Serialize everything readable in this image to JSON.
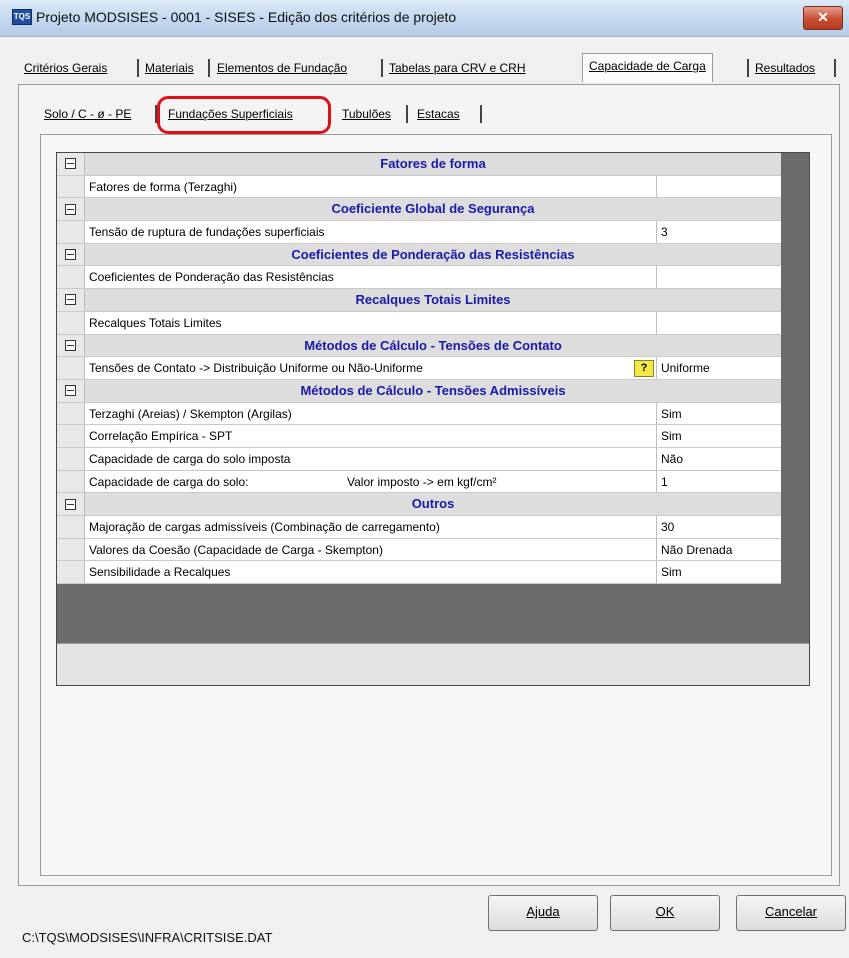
{
  "window": {
    "app_icon": "TQS",
    "title": "Projeto MODSISES - 0001 - SISES - Edição dos critérios de projeto",
    "close_label": "✕"
  },
  "main_tabs": [
    {
      "label": "Critérios Gerais",
      "active": false
    },
    {
      "label": "Materiais",
      "active": false
    },
    {
      "label": "Elementos de Fundação",
      "active": false
    },
    {
      "label": "Tabelas para CRV e CRH",
      "active": false
    },
    {
      "label": "Capacidade de Carga",
      "active": true
    },
    {
      "label": "Resultados",
      "active": false
    }
  ],
  "sub_tabs": [
    {
      "label": "Solo / C - ø - PE",
      "active": false
    },
    {
      "label": "Fundações Superficiais",
      "active": true
    },
    {
      "label": "Tubulões",
      "active": false
    },
    {
      "label": "Estacas",
      "active": false
    }
  ],
  "sections": [
    {
      "title": "Fatores de forma",
      "rows": [
        {
          "label": "Fatores de forma (Terzaghi)",
          "value": ""
        }
      ]
    },
    {
      "title": "Coeficiente Global de Segurança",
      "rows": [
        {
          "label": "Tensão de ruptura de fundações superficiais",
          "value": "3"
        }
      ]
    },
    {
      "title": "Coeficientes de Ponderação das Resistências",
      "rows": [
        {
          "label": "Coeficientes de Ponderação das Resistências",
          "value": ""
        }
      ]
    },
    {
      "title": "Recalques Totais Limites",
      "rows": [
        {
          "label": "Recalques Totais Limites",
          "value": ""
        }
      ]
    },
    {
      "title": "Métodos de Cálculo - Tensões de Contato",
      "rows": [
        {
          "label": "Tensões de Contato  ->  Distribuição Uniforme ou Não-Uniforme",
          "value": "Uniforme",
          "help": "?"
        }
      ]
    },
    {
      "title": "Métodos de Cálculo - Tensões Admissíveis",
      "rows": [
        {
          "label": "Terzaghi (Areias) / Skempton (Argilas)",
          "value": "Sim"
        },
        {
          "label": "Correlação Empírica - SPT",
          "value": "Sim"
        },
        {
          "label": "Capacidade de carga do solo imposta",
          "value": "Não"
        },
        {
          "label": "Capacidade de carga do solo:",
          "extra": "Valor imposto  ->  em kgf/cm²",
          "value": "1"
        }
      ]
    },
    {
      "title": "Outros",
      "rows": [
        {
          "label": "Majoração de cargas admissíveis (Combinação de carregamento)",
          "value": "30"
        },
        {
          "label": "Valores da Coesão (Capacidade de Carga - Skempton)",
          "value": "Não Drenada"
        },
        {
          "label": "Sensibilidade a Recalques",
          "value": "Sim"
        }
      ]
    }
  ],
  "buttons": {
    "help": "Ajuda",
    "ok": "OK",
    "cancel": "Cancelar"
  },
  "status_path": "C:\\TQS\\MODSISES\\INFRA\\CRITSISE.DAT",
  "colors": {
    "section_title": "#1a1aa8",
    "highlight": "#e0101a",
    "help_button": "#f2e84a"
  }
}
